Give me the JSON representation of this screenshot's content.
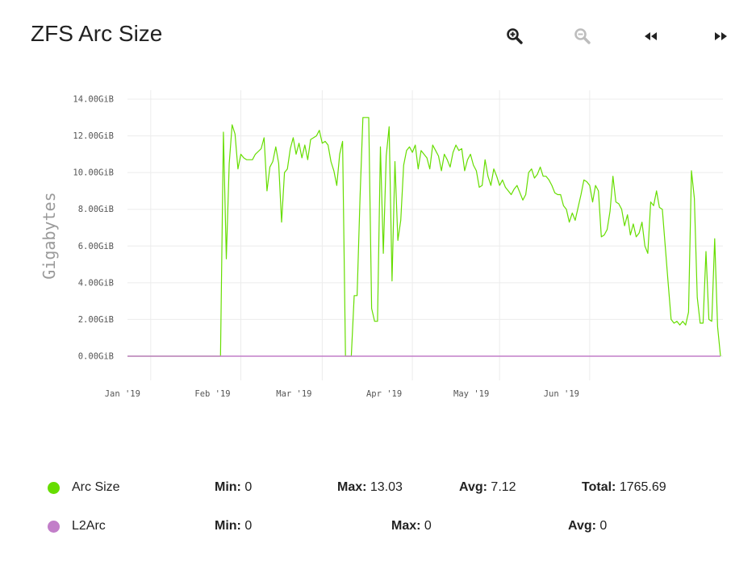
{
  "page": {
    "title": "ZFS Arc Size"
  },
  "toolbar": {
    "zoom_in_icon": "zoom-in-icon",
    "zoom_out_icon": "zoom-out-icon",
    "back_icon": "rewind-icon",
    "forward_icon": "fast-forward-icon"
  },
  "colors": {
    "arc": "#66dd00",
    "l2arc": "#c27ec9",
    "grid": "#ececec",
    "axis_text": "#555555"
  },
  "chart_data": {
    "type": "line",
    "ylabel": "Gigabytes",
    "ylim": [
      0,
      14
    ],
    "y_ticks": [
      {
        "value": 0,
        "label": "0.00GiB"
      },
      {
        "value": 2,
        "label": "2.00GiB"
      },
      {
        "value": 4,
        "label": "4.00GiB"
      },
      {
        "value": 6,
        "label": "6.00GiB"
      },
      {
        "value": 8,
        "label": "8.00GiB"
      },
      {
        "value": 10,
        "label": "10.00GiB"
      },
      {
        "value": 12,
        "label": "12.00GiB"
      },
      {
        "value": 14,
        "label": "14.00GiB"
      }
    ],
    "x_ticks": [
      {
        "label": "Jan '19",
        "date": "2019-01-01"
      },
      {
        "label": "Feb '19",
        "date": "2019-02-01"
      },
      {
        "label": "Mar '19",
        "date": "2019-03-01"
      },
      {
        "label": "Apr '19",
        "date": "2019-04-01"
      },
      {
        "label": "May '19",
        "date": "2019-05-01"
      },
      {
        "label": "Jun '19",
        "date": "2019-06-01"
      }
    ],
    "xlim": [
      "2018-12-24",
      "2019-06-26"
    ],
    "grid": true,
    "legend_position": "bottom",
    "series": [
      {
        "name": "Arc Size",
        "color": "#66dd00",
        "points": [
          [
            "2018-12-24",
            0.0
          ],
          [
            "2019-01-25",
            0.0
          ],
          [
            "2019-01-26",
            12.2
          ],
          [
            "2019-01-27",
            5.3
          ],
          [
            "2019-01-28",
            10.5
          ],
          [
            "2019-01-29",
            12.6
          ],
          [
            "2019-01-30",
            12.1
          ],
          [
            "2019-01-31",
            10.2
          ],
          [
            "2019-02-01",
            11.0
          ],
          [
            "2019-02-02",
            10.8
          ],
          [
            "2019-02-03",
            10.7
          ],
          [
            "2019-02-05",
            10.7
          ],
          [
            "2019-02-06",
            11.0
          ],
          [
            "2019-02-08",
            11.3
          ],
          [
            "2019-02-09",
            11.9
          ],
          [
            "2019-02-10",
            9.0
          ],
          [
            "2019-02-11",
            10.3
          ],
          [
            "2019-02-12",
            10.6
          ],
          [
            "2019-02-13",
            11.4
          ],
          [
            "2019-02-14",
            10.5
          ],
          [
            "2019-02-15",
            7.3
          ],
          [
            "2019-02-16",
            10.0
          ],
          [
            "2019-02-17",
            10.2
          ],
          [
            "2019-02-18",
            11.3
          ],
          [
            "2019-02-19",
            11.9
          ],
          [
            "2019-02-20",
            11.0
          ],
          [
            "2019-02-21",
            11.6
          ],
          [
            "2019-02-22",
            10.8
          ],
          [
            "2019-02-23",
            11.5
          ],
          [
            "2019-02-24",
            10.7
          ],
          [
            "2019-02-25",
            11.8
          ],
          [
            "2019-02-26",
            11.9
          ],
          [
            "2019-02-27",
            12.0
          ],
          [
            "2019-02-28",
            12.3
          ],
          [
            "2019-03-01",
            11.6
          ],
          [
            "2019-03-02",
            11.7
          ],
          [
            "2019-03-03",
            11.5
          ],
          [
            "2019-03-04",
            10.6
          ],
          [
            "2019-03-05",
            10.1
          ],
          [
            "2019-03-06",
            9.3
          ],
          [
            "2019-03-07",
            11.0
          ],
          [
            "2019-03-08",
            11.7
          ],
          [
            "2019-03-09",
            0.0
          ],
          [
            "2019-03-10",
            0.0
          ],
          [
            "2019-03-11",
            0.0
          ],
          [
            "2019-03-12",
            3.3
          ],
          [
            "2019-03-13",
            3.3
          ],
          [
            "2019-03-14",
            8.6
          ],
          [
            "2019-03-15",
            13.0
          ],
          [
            "2019-03-16",
            13.0
          ],
          [
            "2019-03-17",
            13.0
          ],
          [
            "2019-03-18",
            2.6
          ],
          [
            "2019-03-19",
            1.9
          ],
          [
            "2019-03-20",
            1.9
          ],
          [
            "2019-03-21",
            11.4
          ],
          [
            "2019-03-22",
            5.6
          ],
          [
            "2019-03-23",
            10.9
          ],
          [
            "2019-03-24",
            12.5
          ],
          [
            "2019-03-25",
            4.1
          ],
          [
            "2019-03-26",
            10.6
          ],
          [
            "2019-03-27",
            6.3
          ],
          [
            "2019-03-28",
            7.4
          ],
          [
            "2019-03-29",
            10.4
          ],
          [
            "2019-03-30",
            11.2
          ],
          [
            "2019-03-31",
            11.4
          ],
          [
            "2019-04-01",
            11.1
          ],
          [
            "2019-04-02",
            11.5
          ],
          [
            "2019-04-03",
            10.2
          ],
          [
            "2019-04-04",
            11.2
          ],
          [
            "2019-04-05",
            11.0
          ],
          [
            "2019-04-06",
            10.8
          ],
          [
            "2019-04-07",
            10.2
          ],
          [
            "2019-04-08",
            11.5
          ],
          [
            "2019-04-09",
            11.2
          ],
          [
            "2019-04-10",
            10.9
          ],
          [
            "2019-04-11",
            10.1
          ],
          [
            "2019-04-12",
            11.0
          ],
          [
            "2019-04-13",
            10.7
          ],
          [
            "2019-04-14",
            10.3
          ],
          [
            "2019-04-15",
            11.1
          ],
          [
            "2019-04-16",
            11.5
          ],
          [
            "2019-04-17",
            11.2
          ],
          [
            "2019-04-18",
            11.3
          ],
          [
            "2019-04-19",
            10.1
          ],
          [
            "2019-04-20",
            10.7
          ],
          [
            "2019-04-21",
            11.0
          ],
          [
            "2019-04-22",
            10.4
          ],
          [
            "2019-04-23",
            10.1
          ],
          [
            "2019-04-24",
            9.2
          ],
          [
            "2019-04-25",
            9.3
          ],
          [
            "2019-04-26",
            10.7
          ],
          [
            "2019-04-27",
            9.8
          ],
          [
            "2019-04-28",
            9.3
          ],
          [
            "2019-04-29",
            10.2
          ],
          [
            "2019-04-30",
            9.8
          ],
          [
            "2019-05-01",
            9.3
          ],
          [
            "2019-05-02",
            9.6
          ],
          [
            "2019-05-03",
            9.2
          ],
          [
            "2019-05-04",
            9.0
          ],
          [
            "2019-05-05",
            8.8
          ],
          [
            "2019-05-06",
            9.1
          ],
          [
            "2019-05-07",
            9.3
          ],
          [
            "2019-05-08",
            8.9
          ],
          [
            "2019-05-09",
            8.5
          ],
          [
            "2019-05-10",
            8.8
          ],
          [
            "2019-05-11",
            10.0
          ],
          [
            "2019-05-12",
            10.2
          ],
          [
            "2019-05-13",
            9.7
          ],
          [
            "2019-05-14",
            9.9
          ],
          [
            "2019-05-15",
            10.3
          ],
          [
            "2019-05-16",
            9.8
          ],
          [
            "2019-05-17",
            9.8
          ],
          [
            "2019-05-18",
            9.6
          ],
          [
            "2019-05-19",
            9.3
          ],
          [
            "2019-05-20",
            8.9
          ],
          [
            "2019-05-21",
            8.8
          ],
          [
            "2019-05-22",
            8.8
          ],
          [
            "2019-05-23",
            8.2
          ],
          [
            "2019-05-24",
            8.0
          ],
          [
            "2019-05-25",
            7.3
          ],
          [
            "2019-05-26",
            7.8
          ],
          [
            "2019-05-27",
            7.4
          ],
          [
            "2019-05-28",
            8.1
          ],
          [
            "2019-05-29",
            8.8
          ],
          [
            "2019-05-30",
            9.6
          ],
          [
            "2019-05-31",
            9.5
          ],
          [
            "2019-06-01",
            9.3
          ],
          [
            "2019-06-02",
            8.4
          ],
          [
            "2019-06-03",
            9.3
          ],
          [
            "2019-06-04",
            9.0
          ],
          [
            "2019-06-05",
            6.5
          ],
          [
            "2019-06-06",
            6.6
          ],
          [
            "2019-06-07",
            6.9
          ],
          [
            "2019-06-08",
            7.9
          ],
          [
            "2019-06-09",
            9.8
          ],
          [
            "2019-06-10",
            8.4
          ],
          [
            "2019-06-11",
            8.3
          ],
          [
            "2019-06-12",
            8.0
          ],
          [
            "2019-06-13",
            7.1
          ],
          [
            "2019-06-14",
            7.7
          ],
          [
            "2019-06-15",
            6.6
          ],
          [
            "2019-06-16",
            7.2
          ],
          [
            "2019-06-17",
            6.5
          ],
          [
            "2019-06-18",
            6.7
          ],
          [
            "2019-06-19",
            7.3
          ],
          [
            "2019-06-20",
            6.0
          ],
          [
            "2019-06-21",
            5.6
          ],
          [
            "2019-06-22",
            8.4
          ],
          [
            "2019-06-23",
            8.2
          ],
          [
            "2019-06-24",
            9.0
          ],
          [
            "2019-06-25",
            8.1
          ],
          [
            "2019-06-26",
            8.0
          ],
          [
            "2019-06-27",
            6.0
          ],
          [
            "2019-06-28",
            4.0
          ],
          [
            "2019-06-29",
            2.0
          ],
          [
            "2019-06-30",
            1.8
          ],
          [
            "2019-07-01",
            1.9
          ],
          [
            "2019-07-02",
            1.7
          ],
          [
            "2019-07-03",
            1.9
          ],
          [
            "2019-07-04",
            1.7
          ],
          [
            "2019-07-05",
            2.4
          ],
          [
            "2019-07-06",
            10.1
          ],
          [
            "2019-07-07",
            8.6
          ],
          [
            "2019-07-08",
            3.2
          ],
          [
            "2019-07-09",
            1.8
          ],
          [
            "2019-07-10",
            1.8
          ],
          [
            "2019-07-11",
            5.7
          ],
          [
            "2019-07-12",
            2.0
          ],
          [
            "2019-07-13",
            1.9
          ],
          [
            "2019-07-14",
            6.4
          ],
          [
            "2019-07-15",
            1.6
          ],
          [
            "2019-07-16",
            0.0
          ]
        ]
      },
      {
        "name": "L2Arc",
        "color": "#c27ec9",
        "points": [
          [
            "2018-12-24",
            0.0
          ],
          [
            "2019-07-16",
            0.0
          ]
        ]
      }
    ]
  },
  "legend": {
    "rows": [
      {
        "name": "Arc Size",
        "color": "#66dd00",
        "min_label": "Min:",
        "min": "0",
        "max_label": "Max:",
        "max": "13.03",
        "avg_label": "Avg:",
        "avg": "7.12",
        "total_label": "Total:",
        "total": "1765.69"
      },
      {
        "name": "L2Arc",
        "color": "#c27ec9",
        "min_label": "Min:",
        "min": "0",
        "max_label": "Max:",
        "max": "0",
        "avg_label": "Avg:",
        "avg": "0"
      }
    ]
  }
}
